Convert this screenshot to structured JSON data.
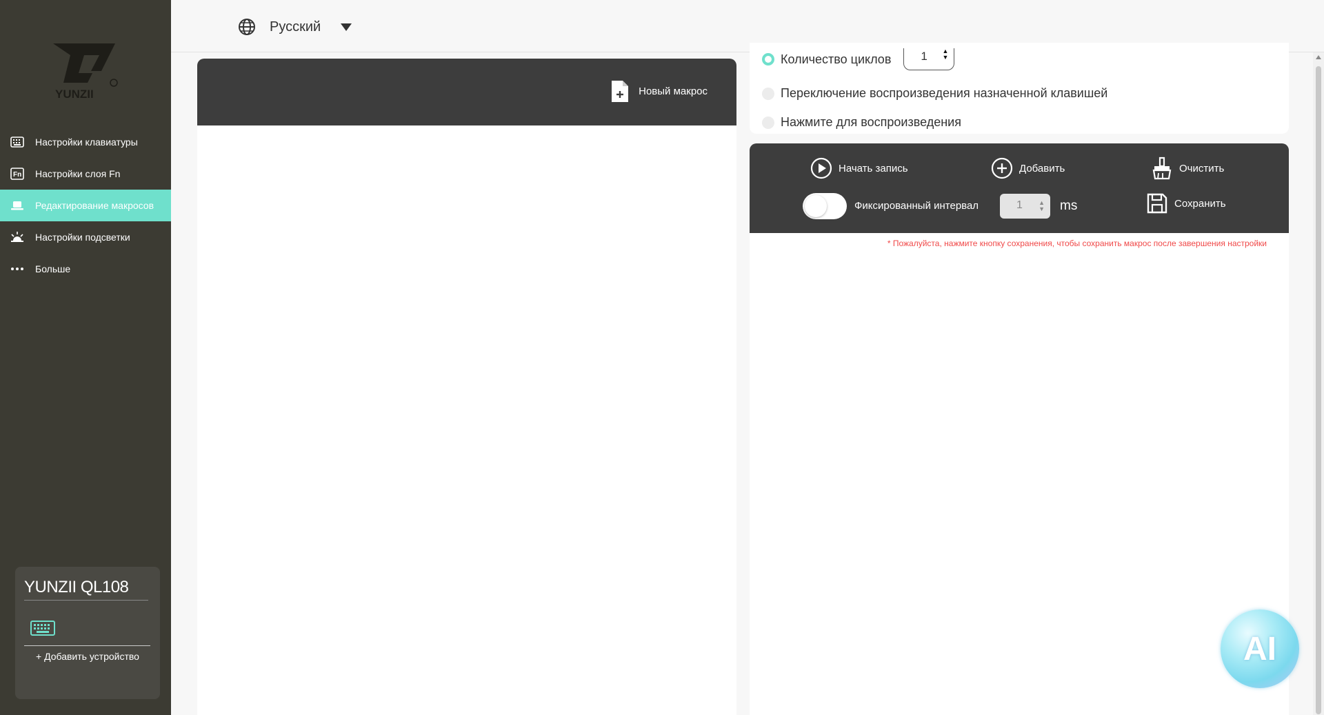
{
  "brand": {
    "logo_text": "YUNZII"
  },
  "nav": {
    "items": [
      {
        "label": "Настройки клавиатуры",
        "icon": "keyboard-icon",
        "active": false
      },
      {
        "label": "Настройки слоя Fn",
        "icon": "fn-icon",
        "active": false
      },
      {
        "label": "Редактирование макросов",
        "icon": "macro-icon",
        "active": true
      },
      {
        "label": "Настройки подсветки",
        "icon": "light-icon",
        "active": false
      },
      {
        "label": "Больше",
        "icon": "more-icon",
        "active": false
      }
    ]
  },
  "device": {
    "name": "YUNZII QL108",
    "add_label": "+ Добавить устройство"
  },
  "language": {
    "selected": "Русский"
  },
  "macro_list": {
    "new_macro_label": "Новый макрос"
  },
  "playback": {
    "cycles_label": "Количество циклов",
    "cycles_value": "1",
    "toggle_key_label": "Переключение воспроизведения назначенной клавишей",
    "press_play_label": "Нажмите для воспроизведения"
  },
  "controls": {
    "start_record": "Начать запись",
    "add": "Добавить",
    "clear": "Очистить",
    "fixed_interval": "Фиксированный интервал",
    "interval_value": "1",
    "interval_unit": "ms",
    "save": "Сохранить"
  },
  "hint": "* Пожалуйста, нажмите кнопку сохранения, чтобы сохранить макрос после завершения настройки",
  "assistant": {
    "label": "AI"
  },
  "colors": {
    "sidebar_bg": "#3c3b33",
    "accent": "#6fe0cc",
    "panel_dark": "#3d3d3d",
    "warning": "#f04848"
  }
}
